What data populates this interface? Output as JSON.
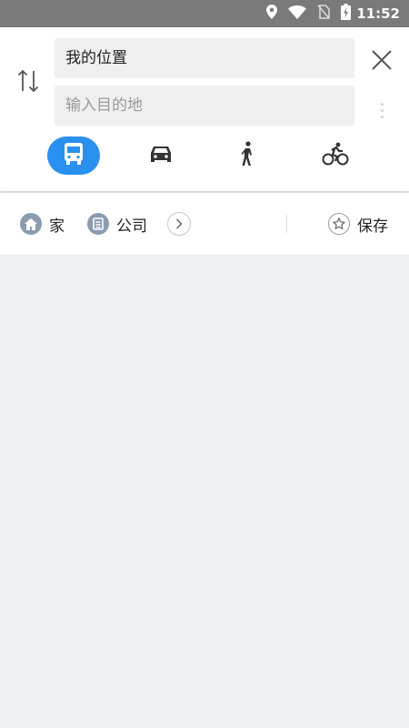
{
  "status_bar": {
    "time": "11:52",
    "icons": [
      "location-icon",
      "wifi-icon",
      "no-sim-icon",
      "battery-charging-icon"
    ]
  },
  "route": {
    "origin": "我的位置",
    "destination_placeholder": "输入目的地",
    "destination_value": ""
  },
  "modes": [
    {
      "name": "bus",
      "icon": "bus-icon",
      "selected": true
    },
    {
      "name": "car",
      "icon": "car-icon",
      "selected": false
    },
    {
      "name": "walk",
      "icon": "walk-icon",
      "selected": false
    },
    {
      "name": "bike",
      "icon": "bike-icon",
      "selected": false
    }
  ],
  "shortcuts": {
    "home": "家",
    "work": "公司",
    "save": "保存"
  },
  "colors": {
    "accent": "#2a90f0",
    "status_bar": "#7a7a7a",
    "shortcut_icon": "#8c9bb0",
    "map_background": "#eeeff1"
  }
}
